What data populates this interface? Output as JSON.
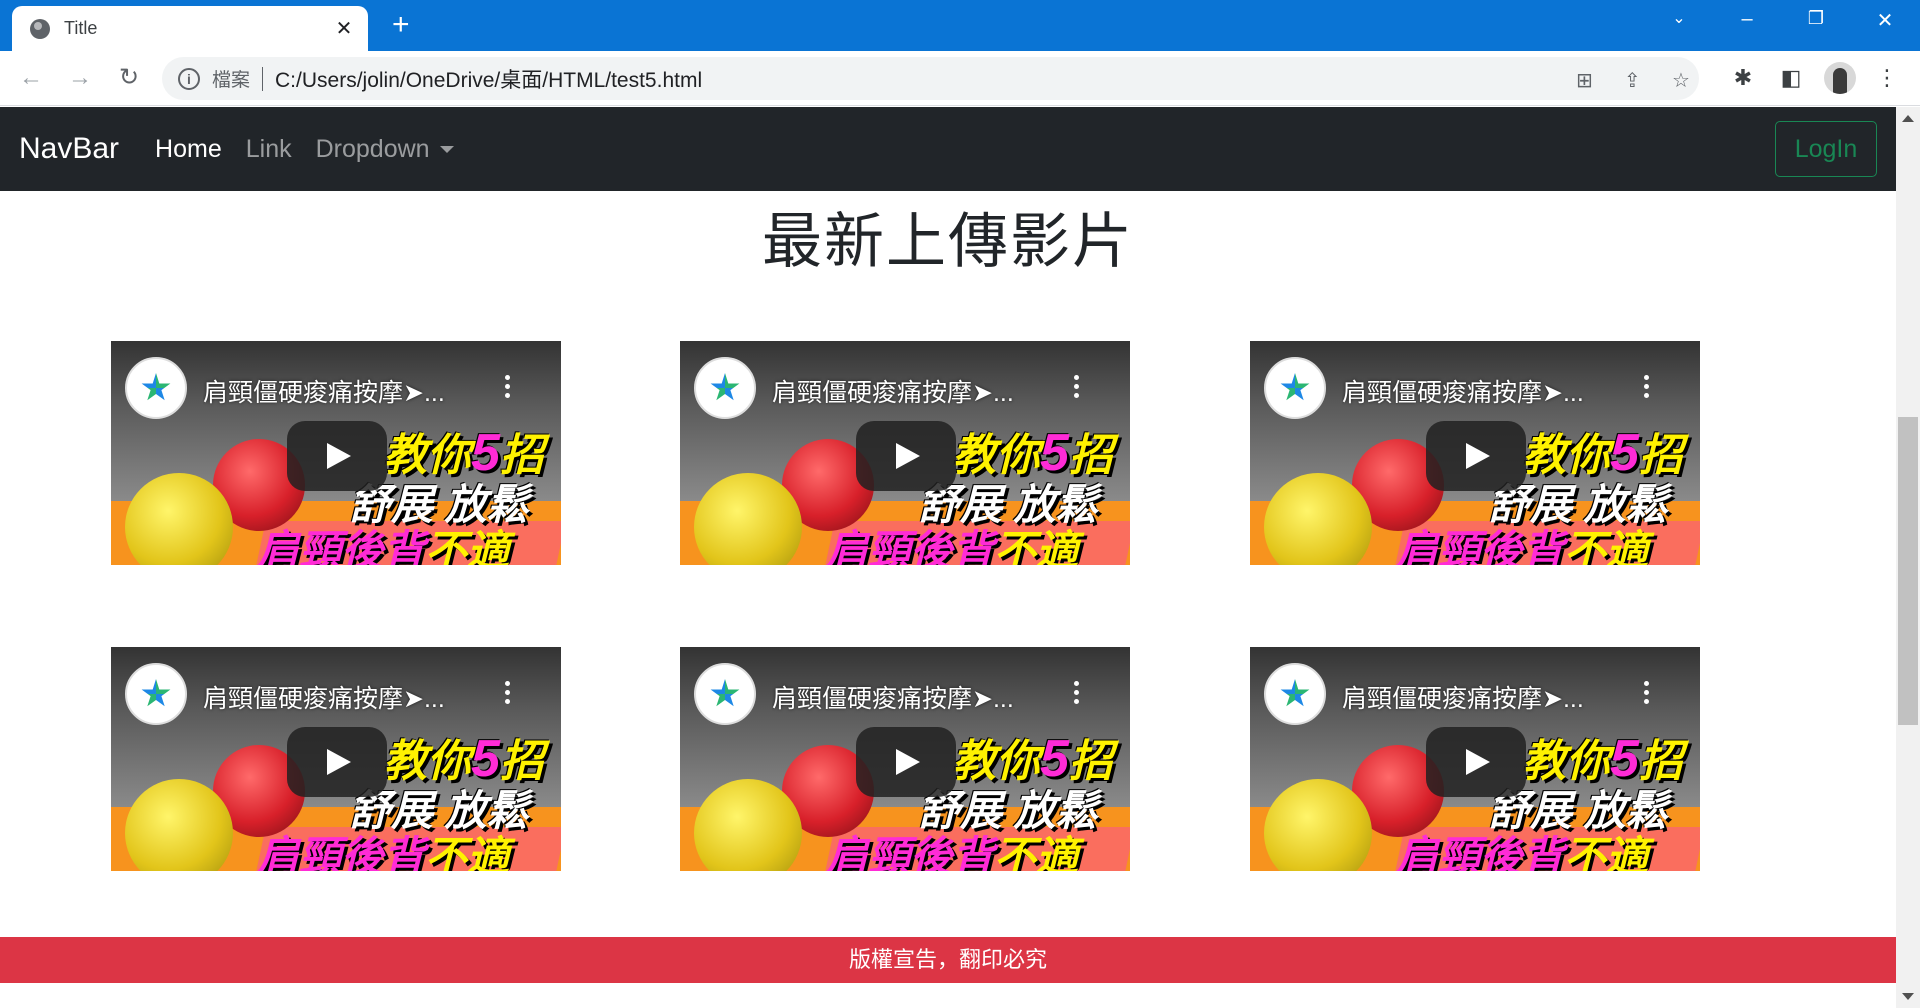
{
  "browser": {
    "tab_title": "Title",
    "tab_close": "✕",
    "new_tab": "+",
    "omnibox_label": "檔案",
    "url": "C:/Users/jolin/OneDrive/桌面/HTML/test5.html"
  },
  "navbar": {
    "brand": "NavBar",
    "links": [
      "Home",
      "Link",
      "Dropdown"
    ],
    "login_label": "LogIn"
  },
  "main": {
    "heading": "最新上傳影片",
    "videos": [
      {
        "title": "肩頸僵硬痠痛按摩➤...",
        "line1": "教你",
        "num": "5",
        "line1b": "招",
        "line2": "舒展 放鬆",
        "line3a": "肩頸後背",
        "line3b": "不適"
      },
      {
        "title": "肩頸僵硬痠痛按摩➤...",
        "line1": "教你",
        "num": "5",
        "line1b": "招",
        "line2": "舒展 放鬆",
        "line3a": "肩頸後背",
        "line3b": "不適"
      },
      {
        "title": "肩頸僵硬痠痛按摩➤...",
        "line1": "教你",
        "num": "5",
        "line1b": "招",
        "line2": "舒展 放鬆",
        "line3a": "肩頸後背",
        "line3b": "不適"
      },
      {
        "title": "肩頸僵硬痠痛按摩➤...",
        "line1": "教你",
        "num": "5",
        "line1b": "招",
        "line2": "舒展 放鬆",
        "line3a": "肩頸後背",
        "line3b": "不適"
      },
      {
        "title": "肩頸僵硬痠痛按摩➤...",
        "line1": "教你",
        "num": "5",
        "line1b": "招",
        "line2": "舒展 放鬆",
        "line3a": "肩頸後背",
        "line3b": "不適"
      },
      {
        "title": "肩頸僵硬痠痛按摩➤...",
        "line1": "教你",
        "num": "5",
        "line1b": "招",
        "line2": "舒展 放鬆",
        "line3a": "肩頸後背",
        "line3b": "不適"
      }
    ]
  },
  "footer": {
    "text": "版權宣告，翻印必究"
  },
  "colors": {
    "chrome_blue": "#0a74d4",
    "navbar_bg": "#212529",
    "login_green": "#198754",
    "footer_red": "#dc3545"
  }
}
